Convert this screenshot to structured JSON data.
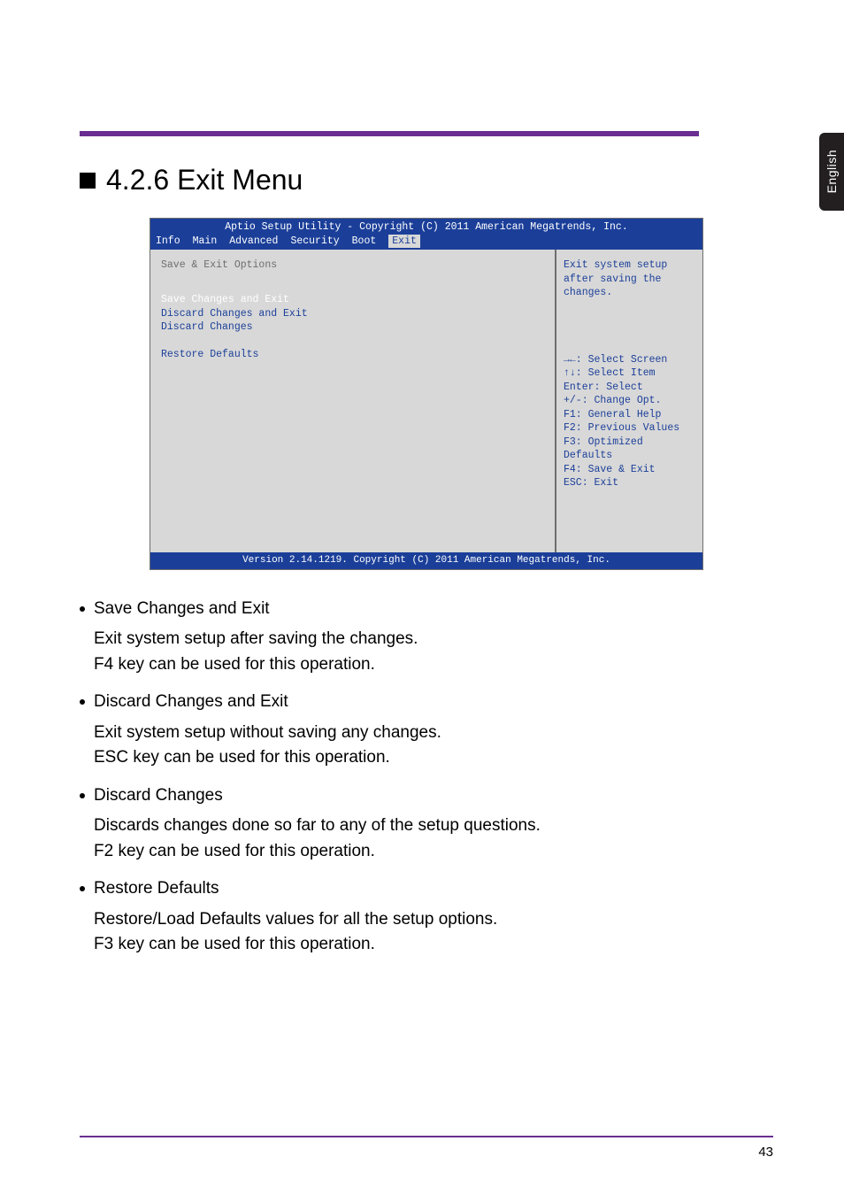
{
  "sideTab": "English",
  "heading": "4.2.6 Exit Menu",
  "bios": {
    "topbar": "Aptio Setup Utility - Copyright (C) 2011 American Megatrends, Inc.",
    "tabs": {
      "t0": "Info",
      "t1": "Main",
      "t2": "Advanced",
      "t3": "Security",
      "t4": "Boot",
      "t5": "Exit"
    },
    "left": {
      "group": "Save & Exit Options",
      "i0": "Save Changes and Exit",
      "i1": "Discard Changes and Exit",
      "i2": "Discard Changes",
      "i3": "Restore Defaults"
    },
    "right": {
      "help1": "Exit system setup",
      "help2": "after saving the",
      "help3": "changes.",
      "k0": "→←: Select Screen",
      "k1": "↑↓: Select Item",
      "k2": "Enter: Select",
      "k3": "+/-: Change Opt.",
      "k4": "F1: General Help",
      "k5": "F2: Previous Values",
      "k6": "F3: Optimized Defaults",
      "k7": "F4: Save & Exit",
      "k8": "ESC: Exit"
    },
    "bottom": "Version 2.14.1219. Copyright (C) 2011 American Megatrends, Inc."
  },
  "body": {
    "b0": {
      "title": "Save Changes and Exit",
      "l1": "Exit system setup after saving the changes.",
      "l2": "F4 key can be used for this operation."
    },
    "b1": {
      "title": "Discard Changes and Exit",
      "l1": "Exit system setup without saving any changes.",
      "l2": "ESC key can be used for this operation."
    },
    "b2": {
      "title": "Discard Changes",
      "l1": "Discards changes done so far to any of the setup questions.",
      "l2": "F2 key can be used for this operation."
    },
    "b3": {
      "title": "Restore Defaults",
      "l1": "Restore/Load Defaults values for all the setup options.",
      "l2": "F3 key can be used for this operation."
    }
  },
  "pageNum": "43"
}
